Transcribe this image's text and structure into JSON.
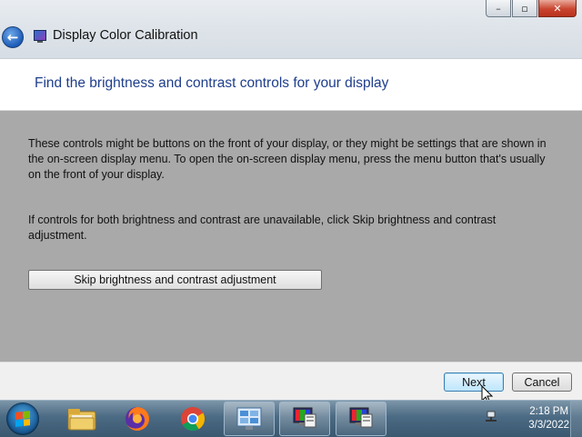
{
  "window": {
    "title": "Display Color Calibration",
    "controls": {
      "minimize": "–",
      "maximize": "▫",
      "close": "✕"
    }
  },
  "page": {
    "heading": "Find the brightness and contrast controls for your display",
    "cut_text": "                                                                                  ",
    "paragraph1": "These controls might be buttons on the front of your display, or they might be settings that are shown in the on-screen display menu. To open the on-screen display menu, press the menu button that's usually on the front of your display.",
    "paragraph2": "If controls for both brightness and contrast are unavailable, click Skip brightness and contrast adjustment.",
    "skip_button": "Skip brightness and contrast adjustment"
  },
  "footer": {
    "next_label": "Next",
    "cancel_label": "Cancel"
  },
  "taskbar": {
    "items": [
      "file-explorer-icon",
      "firefox-icon",
      "chrome-icon",
      "control-panel-icon",
      "display-calibration-icon",
      "display-calibration-icon"
    ],
    "time": "2:18 PM",
    "date": "3/3/2022"
  }
}
